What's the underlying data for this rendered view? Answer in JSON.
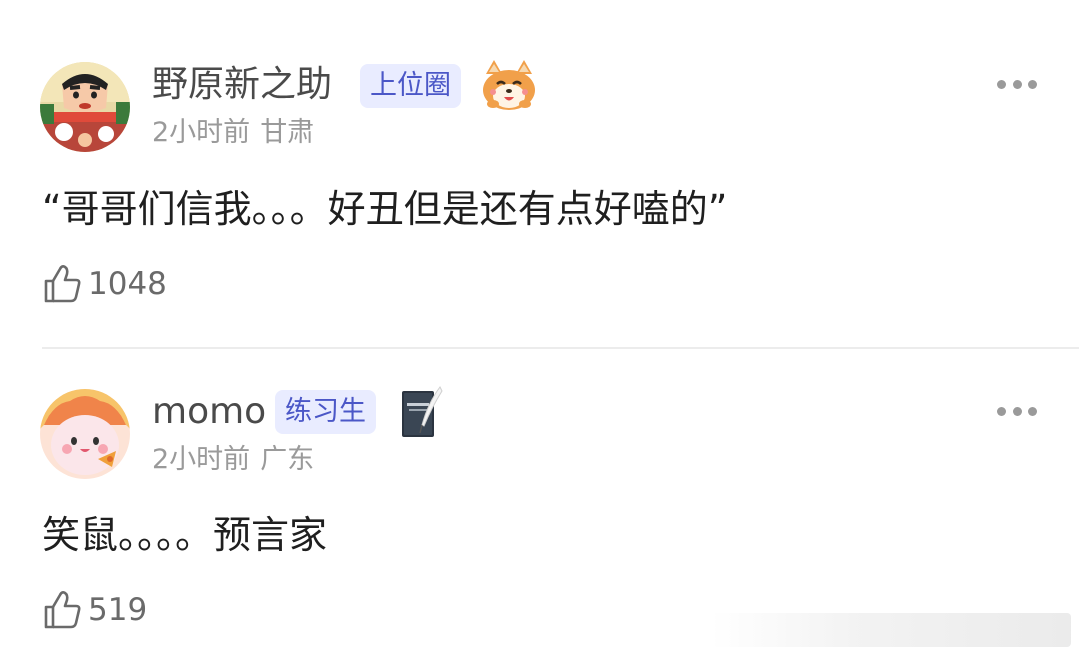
{
  "comments": [
    {
      "username": "野原新之助",
      "badge": "上位圈",
      "avatar_icon": "crayon-shinchan-avatar",
      "sticker_icon": "shiba-dog-sticker",
      "time": "2小时前",
      "location": "甘肃",
      "content": "“哥哥们信我。。。好丑但是还有点好嗑的”",
      "likes": "1048"
    },
    {
      "username": "momo",
      "badge": "练习生",
      "avatar_icon": "cartoon-girl-avatar",
      "sticker_icon": "notebook-quill-sticker",
      "time": "2小时前",
      "location": "广东",
      "content": "笑鼠。。。。预言家",
      "likes": "519"
    }
  ],
  "colors": {
    "badge_bg": "#e9ecff",
    "badge_text": "#4b57c7",
    "meta_text": "#9a9a9a",
    "divider": "#ececec"
  }
}
